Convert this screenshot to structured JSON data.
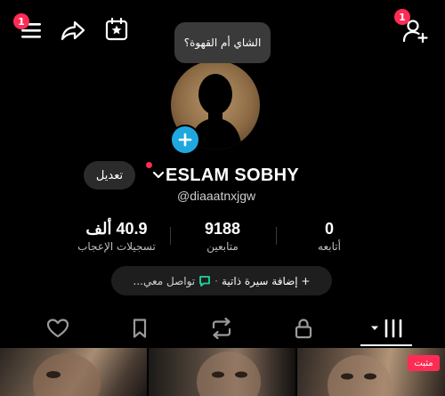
{
  "header": {
    "menu_badge": "1",
    "add_friend_badge": "1",
    "bubble_text": "الشاي أم القهوة؟"
  },
  "profile": {
    "edit_label": "تعديل",
    "name": "ESLAM SOBHY",
    "handle": "@diaaatnxjgw"
  },
  "stats": [
    {
      "value": "40.9 ألف",
      "label": "تسجيلات الإعجاب"
    },
    {
      "value": "9188",
      "label": "متابعين"
    },
    {
      "value": "0",
      "label": "أتابعه"
    }
  ],
  "bio": {
    "add_bio": "+ إضافة سيرة ذاتية",
    "separator": "·",
    "contact": "تواصل معي..."
  },
  "tabs": [
    "liked",
    "saved",
    "reposts",
    "private",
    "videos"
  ],
  "pinned_label": "مثبت",
  "colors": {
    "accent": "#fe2c55",
    "plus": "#1fa8e0",
    "contact_icon": "#20d5a0"
  }
}
